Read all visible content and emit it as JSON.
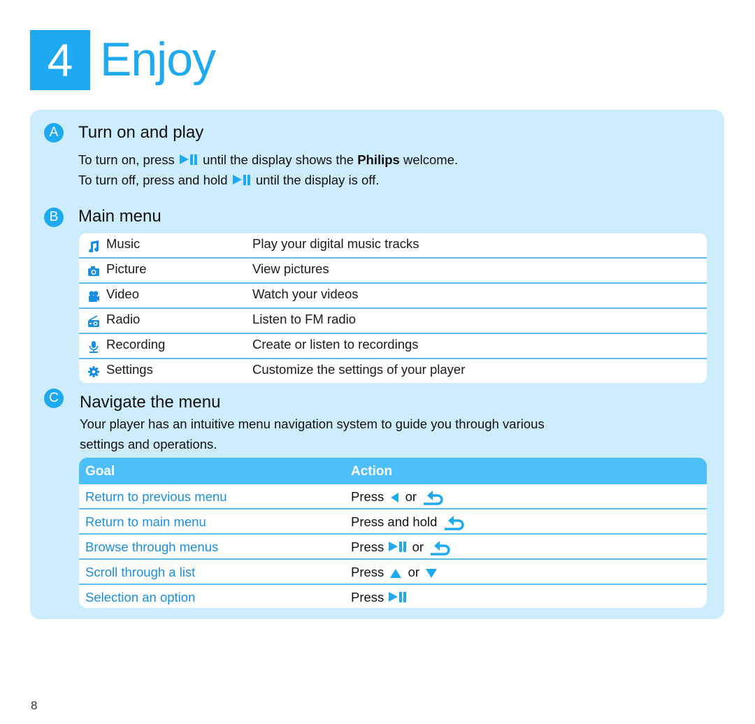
{
  "header": {
    "step_number": "4",
    "title": "Enjoy"
  },
  "colors": {
    "accent": "#1fa9f0",
    "panel_bg": "#cdecfc",
    "table_header": "#4dbff7",
    "divider": "#5dbff0",
    "goal_text": "#1a8fe0"
  },
  "section_a": {
    "badge": "A",
    "title": "Turn on and play",
    "line1_pre": "To turn on, press",
    "line1_icon": "play-pause-icon",
    "line1_mid": "until the display shows the",
    "line1_bold": "Philips",
    "line1_post": "welcome.",
    "line2_pre": "To turn off, press and hold",
    "line2_icon": "play-pause-icon",
    "line2_post": "until the display is off."
  },
  "section_b": {
    "badge": "B",
    "title": "Main menu",
    "items": [
      {
        "icon": "music-note-icon",
        "name": "Music",
        "description": "Play your digital music tracks"
      },
      {
        "icon": "camera-icon",
        "name": "Picture",
        "description": "View pictures"
      },
      {
        "icon": "video-camera-icon",
        "name": "Video",
        "description": "Watch your videos"
      },
      {
        "icon": "radio-icon",
        "name": "Radio",
        "description": "Listen to FM radio"
      },
      {
        "icon": "microphone-icon",
        "name": "Recording",
        "description": "Create or listen to recordings"
      },
      {
        "icon": "gear-icon",
        "name": "Settings",
        "description": "Customize the settings of your player"
      }
    ]
  },
  "section_c": {
    "badge": "C",
    "title": "Navigate the menu",
    "intro_line1": "Your player has an intuitive menu navigation system to guide you through various",
    "intro_line2": "settings and operations.",
    "table": {
      "headers": {
        "goal": "Goal",
        "action": "Action"
      },
      "rows": [
        {
          "goal": "Return to previous menu",
          "action_pre": "Press",
          "icon1": "left-arrow-icon",
          "or": "or",
          "icon2": "back-icon",
          "action_post": ""
        },
        {
          "goal": "Return to main menu",
          "action_pre": "Press and hold",
          "icon1": "back-icon",
          "or": "",
          "icon2": "",
          "action_post": ""
        },
        {
          "goal": "Browse through menus",
          "action_pre": "Press",
          "icon1": "play-pause-icon",
          "or": "or",
          "icon2": "back-icon",
          "action_post": ""
        },
        {
          "goal": "Scroll through a list",
          "action_pre": "Press",
          "icon1": "up-arrow-icon",
          "or": "or",
          "icon2": "down-arrow-icon",
          "action_post": ""
        },
        {
          "goal": "Selection an option",
          "action_pre": "Press",
          "icon1": "play-pause-icon",
          "or": "",
          "icon2": "",
          "action_post": ""
        }
      ]
    }
  },
  "footer": {
    "page_number": "8"
  }
}
